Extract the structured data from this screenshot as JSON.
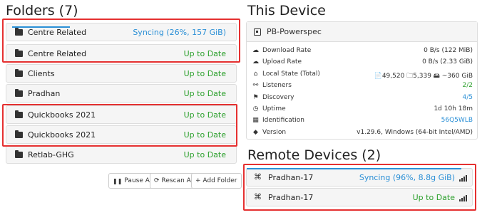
{
  "folders": {
    "title": "Folders (7)",
    "items": [
      {
        "name": "Centre Related",
        "status": "Syncing (26%, 157 GiB)",
        "status_color": "#2a8fd6",
        "progress": 0.26
      },
      {
        "name": "Centre Related",
        "status": "Up to Date",
        "status_color": "#2ca02c"
      },
      {
        "name": "Clients",
        "status": "Up to Date",
        "status_color": "#2ca02c"
      },
      {
        "name": "Pradhan",
        "status": "Up to Date",
        "status_color": "#2ca02c"
      },
      {
        "name": "Quickbooks 2021",
        "status": "Up to Date",
        "status_color": "#2ca02c"
      },
      {
        "name": "Quickbooks 2021",
        "status": "Up to Date",
        "status_color": "#2ca02c"
      },
      {
        "name": "Retlab-GHG",
        "status": "Up to Date",
        "status_color": "#2ca02c"
      }
    ],
    "buttons": {
      "pause_all": "Pause All",
      "rescan_all": "Rescan All",
      "add_folder": "+ Add Folder"
    }
  },
  "this_device": {
    "title": "This Device",
    "name": "PB-Powerspec",
    "stats": [
      {
        "icon": "cloud-download-icon",
        "label": "Download Rate",
        "value": "0 B/s (122 MiB)"
      },
      {
        "icon": "cloud-upload-icon",
        "label": "Upload Rate",
        "value": "0 B/s (2.33 GiB)"
      },
      {
        "icon": "home-icon",
        "label": "Local State (Total)",
        "value": "📄49,520  🗀5,339  🖴 ~360 GiB"
      },
      {
        "icon": "sitemap-icon",
        "label": "Listeners",
        "value": "2/2",
        "color": "#2ca02c"
      },
      {
        "icon": "signpost-icon",
        "label": "Discovery",
        "value": "4/5",
        "color": "#2a8fd6"
      },
      {
        "icon": "clock-icon",
        "label": "Uptime",
        "value": "1d 10h 18m"
      },
      {
        "icon": "qrcode-icon",
        "label": "Identification",
        "value": "56Q5WLB",
        "color": "#2a8fd6"
      },
      {
        "icon": "tag-icon",
        "label": "Version",
        "value": "v1.29.6, Windows (64-bit Intel/AMD)"
      }
    ]
  },
  "remote_devices": {
    "title": "Remote Devices (2)",
    "items": [
      {
        "name": "Pradhan-17",
        "status": "Syncing (96%, 8.8g GiB)",
        "status_color": "#2a8fd6",
        "progress": 0.96
      },
      {
        "name": "Pradhan-17",
        "status": "Up to Date",
        "status_color": "#2ca02c"
      }
    ]
  }
}
